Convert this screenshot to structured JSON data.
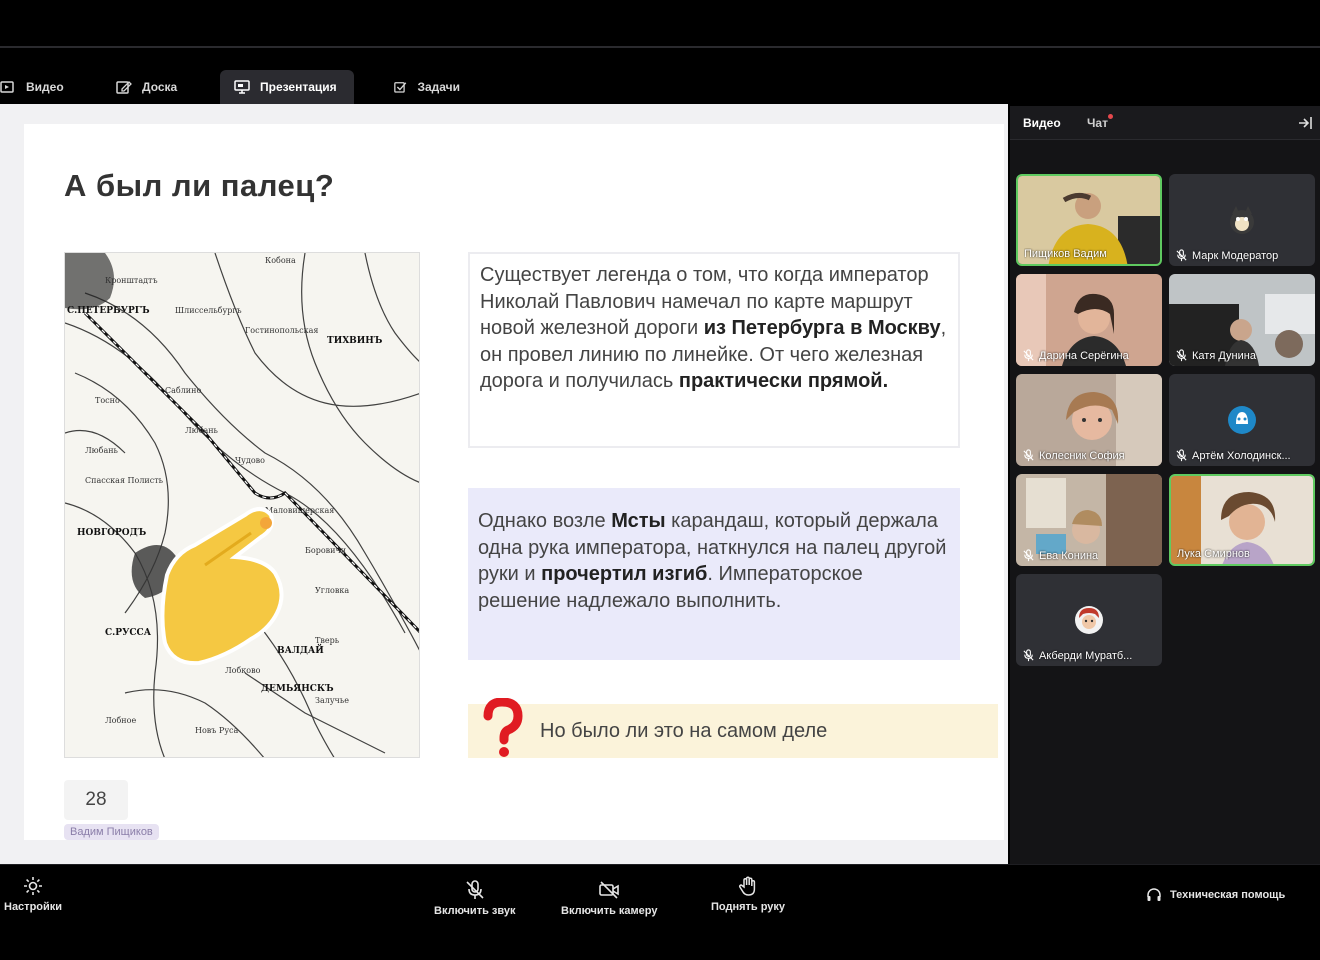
{
  "tabs": [
    {
      "label": "Видео",
      "icon": "video-icon"
    },
    {
      "label": "Доска",
      "icon": "edit-board-icon"
    },
    {
      "label": "Презентация",
      "icon": "presentation-icon",
      "active": true
    },
    {
      "label": "Задачи",
      "icon": "tasks-icon"
    }
  ],
  "slide": {
    "title": "А был ли палец?",
    "map_labels": [
      "С.ПЕТЕРБУРГЪ",
      "НОВГОРОДЪ",
      "ВАЛДАЙ",
      "С.РУССА",
      "ДЕМЬЯНСКЪ",
      "ТИХВИНЪ"
    ],
    "box1": {
      "part1": "Существует легенда о том, что когда император Николай Павлович намечал по карте маршрут новой железной дороги ",
      "bold1": "из Петербурга в Москву",
      "part2": ", он провел линию по линейке. От чего железная дорога и получилась ",
      "bold2": "практически прямой."
    },
    "box2": {
      "part1": "Однако возле ",
      "bold1": "Мсты",
      "part2": " карандаш, который держала одна рука императора, наткнулся на палец другой руки и ",
      "bold2": "прочертил изгиб",
      "part3": ". Императорское решение надлежало выполнить."
    },
    "box3": "Но было ли это на самом деле",
    "page_number": "28",
    "author": "Вадим Пищиков"
  },
  "right_panel": {
    "tab_video": "Видео",
    "tab_chat": "Чат",
    "participants": [
      {
        "name": "Пищиков Вадим",
        "muted": false,
        "camera": true,
        "speaking": true
      },
      {
        "name": "Марк Модератор",
        "muted": true,
        "camera": false
      },
      {
        "name": "Дарина Серёгина",
        "muted": true,
        "camera": true
      },
      {
        "name": "Катя Дунина",
        "muted": true,
        "camera": true
      },
      {
        "name": "Колесник София",
        "muted": true,
        "camera": true
      },
      {
        "name": "Артём Холодинск...",
        "muted": true,
        "camera": false
      },
      {
        "name": "Ева Конина",
        "muted": true,
        "camera": true
      },
      {
        "name": "Лука Смирнов",
        "muted": false,
        "camera": true,
        "speaking": true
      },
      {
        "name": "Акберди Муратб...",
        "muted": true,
        "camera": false
      }
    ]
  },
  "bottom": {
    "settings": "Настройки",
    "mic": "Включить звук",
    "camera": "Включить камеру",
    "hand": "Поднять руку",
    "help": "Техническая помощь"
  },
  "colors": {
    "accent_green": "#5fca60",
    "panel_bg": "#141416",
    "chat_dot": "#e5484d",
    "question_red": "#e01b22"
  }
}
